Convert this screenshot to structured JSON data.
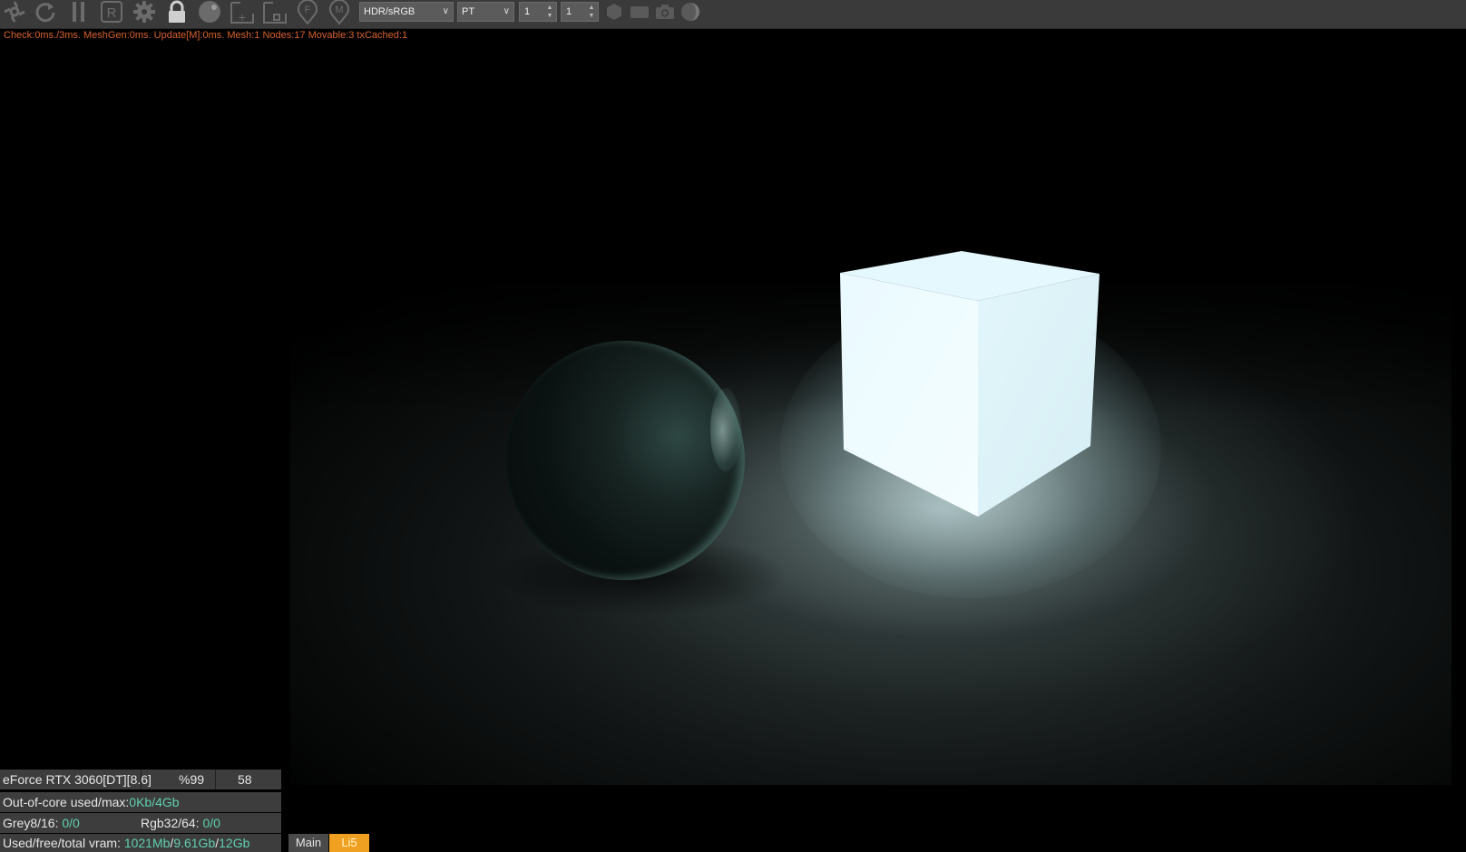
{
  "toolbar": {
    "icons": [
      "settings-spin-icon",
      "refresh-icon",
      "pause-icon",
      "r-icon",
      "gear-icon",
      "lock-icon",
      "sphere-icon",
      "add-frame-icon",
      "frame-icon",
      "f-pin-icon",
      "m-pin-icon"
    ],
    "color_mode": "HDR/sRGB",
    "render_mode": "PT",
    "spin1": "1",
    "spin2": "1",
    "right_icons": [
      "hexagon-icon",
      "film-icon",
      "camera-icon",
      "material-ball-icon"
    ]
  },
  "stats_line": "Check:0ms./3ms. MeshGen:0ms. Update[M]:0ms. Mesh:1 Nodes:17 Movable:3 txCached:1",
  "gpu": {
    "name": "eForce RTX 3060[DT][8.6]",
    "percent": "%99",
    "value": "58"
  },
  "ooc": {
    "label": "Out-of-core used/max:",
    "value": "0Kb/4Gb"
  },
  "grey": {
    "label": "Grey8/16: ",
    "value": "0/0"
  },
  "rgb": {
    "label": "Rgb32/64: ",
    "value": "0/0"
  },
  "vram": {
    "label": "Used/free/total vram: ",
    "used": "1021Mb",
    "slash1": "/",
    "free": "9.61Gb",
    "slash2": "/",
    "total": "12Gb"
  },
  "tabs": {
    "main": "Main",
    "li5": "Li5"
  },
  "colors": {
    "accent": "#f0a020",
    "value_green": "#5fd0b0",
    "stats_orange": "#d9622b"
  }
}
